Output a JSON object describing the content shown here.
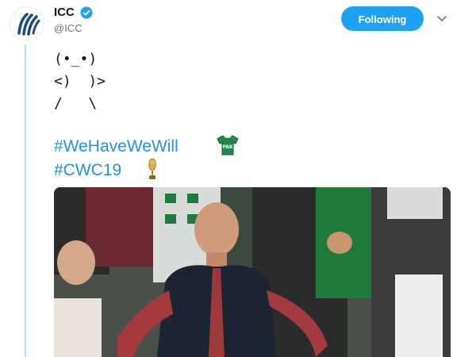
{
  "account": {
    "name": "ICC",
    "handle": "@ICC",
    "verified": true,
    "avatar_icon": "icc-logo-icon"
  },
  "follow_button": {
    "label": "Following",
    "color": "#1da1f2"
  },
  "menu_icon": "chevron-down-icon",
  "tweet": {
    "ascii_art": [
      "(•_•)",
      "<)  )>",
      "/   \\"
    ],
    "hashtags": [
      "#WeHaveWeWill",
      "#CWC19"
    ],
    "emojis": [
      "pakistan-jersey-icon",
      "trophy-icon"
    ],
    "hashtag_color": "#1b95e0"
  },
  "media": {
    "type": "photo",
    "subject": "tweet-photo"
  },
  "colors": {
    "thread_line": "#b3ddf5",
    "text": "#14171a",
    "secondary_text": "#657786"
  }
}
